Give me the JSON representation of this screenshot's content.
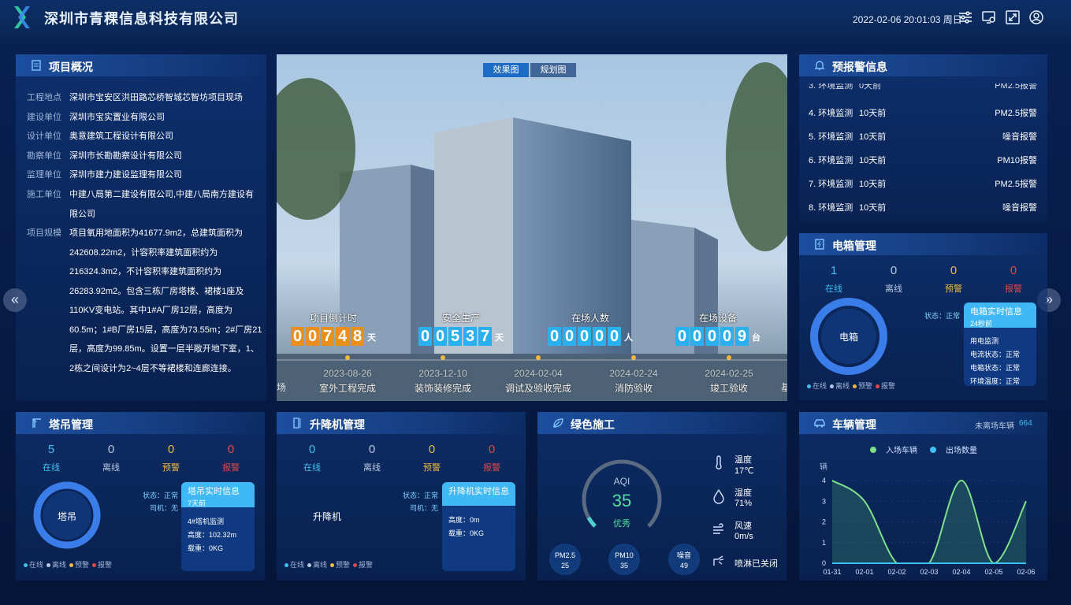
{
  "header": {
    "title": "深圳市青稞信息科技有限公司",
    "datetime": "2022-02-06 20:01:03 周日"
  },
  "project": {
    "title": "项目概况",
    "rows": [
      {
        "k": "工程地点",
        "v": "深圳市宝安区洪田路芯桥智城芯智坊项目现场"
      },
      {
        "k": "建设单位",
        "v": "深圳市宝实置业有限公司"
      },
      {
        "k": "设计单位",
        "v": "奥意建筑工程设计有限公司"
      },
      {
        "k": "勘察单位",
        "v": "深圳市长勘勘察设计有限公司"
      },
      {
        "k": "监理单位",
        "v": "深圳市建力建设监理有限公司"
      },
      {
        "k": "施工单位",
        "v": "中建八局第二建设有限公司,中建八局南方建设有限公司"
      },
      {
        "k": "项目规模",
        "v": "项目氧用地面积为41677.9m2，总建筑面积为242608.22m2，计容积率建筑面积约为216324.3m2，不计容积率建筑面积约为26283.92m2。包含三栋厂房塔楼、裙楼1座及110KV变电站。其中1#A厂房12层，高度为60.5m；1#B厂房15层，高度为73.55m；2#厂房21层，高度为99.85m。设置一层半敞开地下室，1、2栋之间设计为2~4层不等裙楼和连廊连接。"
      }
    ]
  },
  "center": {
    "tabs": [
      "效果图",
      "规划图"
    ],
    "counters": [
      {
        "label": "项目倒计时",
        "digits": [
          "0",
          "0",
          "7",
          "4",
          "8"
        ],
        "unit": "天",
        "color": "#e8901e"
      },
      {
        "label": "安全生产",
        "digits": [
          "0",
          "0",
          "5",
          "3",
          "7"
        ],
        "unit": "天",
        "color": "#2ab0ee"
      },
      {
        "label": "在场人数",
        "digits": [
          "0",
          "0",
          "0",
          "0",
          "0"
        ],
        "unit": "人",
        "color": "#2ab0ee"
      },
      {
        "label": "在场设备",
        "digits": [
          "0",
          "0",
          "0",
          "0",
          "9"
        ],
        "unit": "台",
        "color": "#2ab0ee"
      }
    ],
    "timeline": [
      {
        "date": "2023-08-26",
        "label": "室外工程完成"
      },
      {
        "date": "2023-12-10",
        "label": "装饰装修完成"
      },
      {
        "date": "2024-02-04",
        "label": "调试及验收完成"
      },
      {
        "date": "2024-02-24",
        "label": "消防验收"
      },
      {
        "date": "2024-02-25",
        "label": "竣工验收"
      }
    ],
    "edge_left": "场",
    "edge_right": "基"
  },
  "alerts": {
    "title": "预报警信息",
    "partial": {
      "a": "3. 环境监测",
      "b": "0天前",
      "c": "PM2.5报警"
    },
    "rows": [
      {
        "a": "4. 环境监测",
        "b": "10天前",
        "c": "PM2.5报警"
      },
      {
        "a": "5. 环境监测",
        "b": "10天前",
        "c": "噪音报警"
      },
      {
        "a": "6. 环境监测",
        "b": "10天前",
        "c": "PM10报警"
      },
      {
        "a": "7. 环境监测",
        "b": "10天前",
        "c": "PM2.5报警"
      },
      {
        "a": "8. 环境监测",
        "b": "10天前",
        "c": "噪音报警"
      }
    ]
  },
  "electric": {
    "title": "电箱管理",
    "stats": [
      {
        "n": "1",
        "l": "在线"
      },
      {
        "n": "0",
        "l": "离线"
      },
      {
        "n": "0",
        "l": "预警"
      },
      {
        "n": "0",
        "l": "报警"
      }
    ],
    "ring": "电箱",
    "status": "状态：正常",
    "card": {
      "title": "电箱实时信息",
      "sub": "24秒前",
      "lines": [
        "用电监测",
        "电流状态：正常",
        "电箱状态：正常",
        "环境温度：正常"
      ]
    },
    "legend": [
      "在线",
      "离线",
      "预警",
      "报警"
    ]
  },
  "tower": {
    "title": "塔吊管理",
    "stats": [
      {
        "n": "5",
        "l": "在线"
      },
      {
        "n": "0",
        "l": "离线"
      },
      {
        "n": "0",
        "l": "预警"
      },
      {
        "n": "0",
        "l": "报警"
      }
    ],
    "ring": "塔吊",
    "status": "状态：正常",
    "driver": "司机：无",
    "card": {
      "title": "塔吊实时信息",
      "sub": "7天前",
      "lines": [
        "4#塔机监测",
        "高度：102.32m",
        "载重：0KG"
      ]
    },
    "legend": [
      "在线",
      "离线",
      "预警",
      "报警"
    ]
  },
  "lift": {
    "title": "升降机管理",
    "stats": [
      {
        "n": "0",
        "l": "在线"
      },
      {
        "n": "0",
        "l": "离线"
      },
      {
        "n": "0",
        "l": "预警"
      },
      {
        "n": "0",
        "l": "报警"
      }
    ],
    "ring": "升降机",
    "status": "状态：正常",
    "driver": "司机：无",
    "card": {
      "title": "升降机实时信息",
      "lines": [
        "高度：0m",
        "载重：0KG"
      ]
    },
    "legend": [
      "在线",
      "离线",
      "预警",
      "报警"
    ]
  },
  "green": {
    "title": "绿色施工",
    "aqi_label": "AQI",
    "aqi": "35",
    "aqi_level": "优秀",
    "aqi_fraction": 0.35,
    "bubbles": [
      {
        "k": "PM2.5",
        "v": "25"
      },
      {
        "k": "PM10",
        "v": "35"
      },
      {
        "k": "噪音",
        "v": "49"
      }
    ],
    "env": [
      {
        "k": "温度",
        "v": "17℃"
      },
      {
        "k": "湿度",
        "v": "71%"
      },
      {
        "k": "风速",
        "v": "0m/s"
      },
      {
        "k": "喷淋已关闭",
        "v": ""
      }
    ]
  },
  "vehicle": {
    "title": "车辆管理",
    "unexit_label": "未离场车辆",
    "unexit": "664",
    "chart_data": {
      "type": "line",
      "x": [
        "01-31",
        "02-01",
        "02-02",
        "02-03",
        "02-04",
        "02-05",
        "02-06"
      ],
      "series": [
        {
          "name": "入场车辆",
          "values": [
            4,
            3,
            0,
            0,
            4,
            0,
            3
          ]
        },
        {
          "name": "出场数量",
          "values": [
            0,
            0,
            0,
            0,
            0,
            0,
            0
          ]
        }
      ],
      "ylabel": "辆",
      "ylim": [
        0,
        4
      ],
      "yticks": [
        "0",
        "1",
        "2",
        "3",
        "4"
      ]
    },
    "colors": {
      "in": "#7fe08a",
      "out": "#3fc0f0"
    }
  }
}
